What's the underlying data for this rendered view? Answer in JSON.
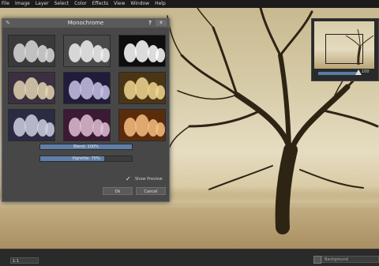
{
  "menu": [
    "File",
    "Image",
    "Layer",
    "Select",
    "Color",
    "Effects",
    "View",
    "Window",
    "Help"
  ],
  "dialog": {
    "title": "Monochrome",
    "help": "?",
    "close": "x",
    "presets": [
      {
        "name": "preset-neutral",
        "bg": "#3a3a3a",
        "fg": "#d9d9d9"
      },
      {
        "name": "preset-light",
        "bg": "#4a4a4a",
        "fg": "#f0f0f0"
      },
      {
        "name": "preset-contrast",
        "bg": "#0e0e0e",
        "fg": "#ffffff"
      },
      {
        "name": "preset-sepia",
        "bg": "#3b3040",
        "fg": "#e2d2b2"
      },
      {
        "name": "preset-blue",
        "bg": "#201c3a",
        "fg": "#c9c3e6"
      },
      {
        "name": "preset-gold",
        "bg": "#4a3514",
        "fg": "#f1d690"
      },
      {
        "name": "preset-cool",
        "bg": "#2b2b44",
        "fg": "#cfcfe0"
      },
      {
        "name": "preset-magenta",
        "bg": "#3a1a34",
        "fg": "#e0bfd4"
      },
      {
        "name": "preset-orange",
        "bg": "#5a2c0c",
        "fg": "#f6be80"
      }
    ],
    "blend_label": "Blend: 100%",
    "blend_value": 100,
    "vignette_label": "Vignette: 70%",
    "vignette_value": 70,
    "show_preview": "Show Preview",
    "ok": "Ok",
    "cancel": "Cancel"
  },
  "navigator": {
    "zoom": "100"
  },
  "bottom": {
    "zoom_select": "1:1",
    "layer_field": "Background"
  },
  "colors": {
    "accent": "#5f7ea9"
  }
}
